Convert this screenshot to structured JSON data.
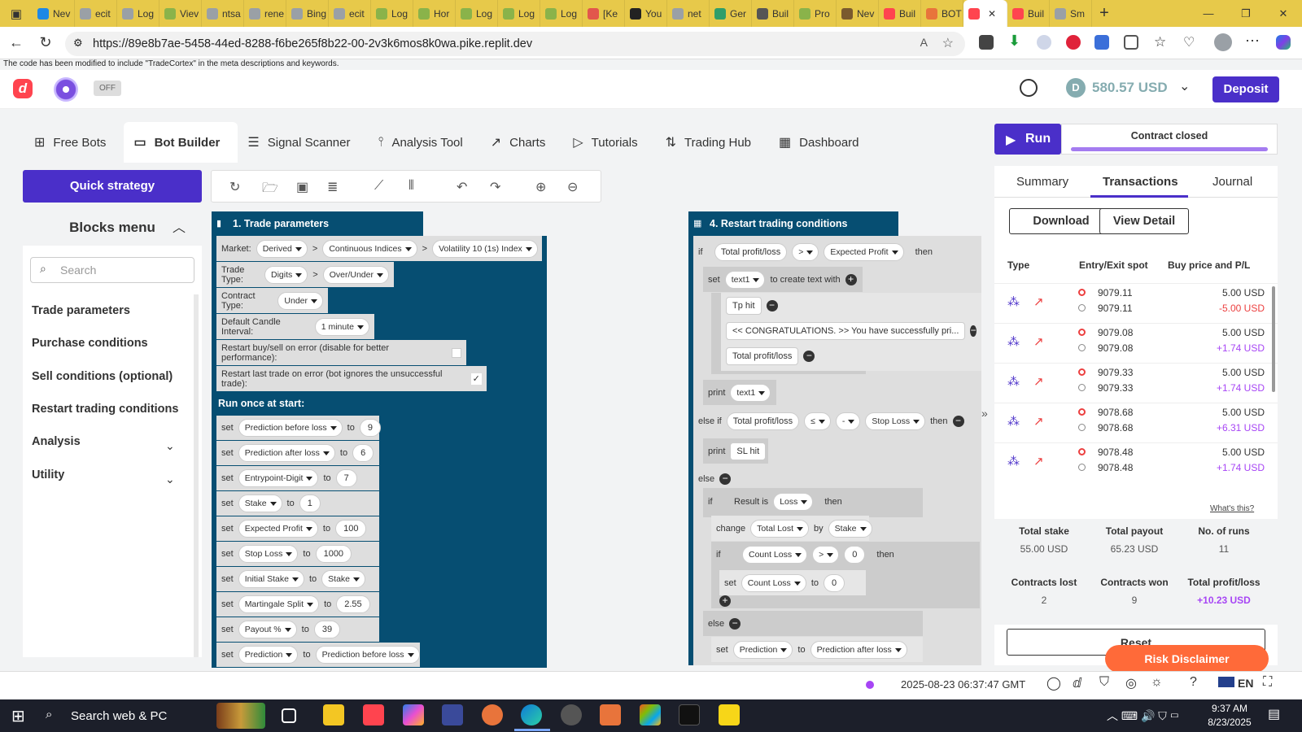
{
  "browser": {
    "tabs": [
      "Nev",
      "ecit",
      "Log",
      "Viev",
      "ntsa",
      "rene",
      "Bing",
      "ecit",
      "Log",
      "Hor",
      "Log",
      "Log",
      "Log",
      "[Ke",
      "You",
      "net",
      "Ger",
      "Buil",
      "Pro",
      "Nev",
      "Buil",
      "BOT",
      "",
      "Buil",
      "Sm"
    ],
    "url": "https://89e8b7ae-5458-44ed-8288-f6be265f8b22-00-2v3k6mos8k0wa.pike.replit.dev"
  },
  "notice": "The code has been modified to include \"TradeCortex\" in the meta descriptions and keywords.",
  "header": {
    "off": "OFF",
    "balance": "580.57 USD",
    "deposit": "Deposit"
  },
  "tabs": [
    {
      "label": "Free Bots",
      "icon": "grid-icon"
    },
    {
      "label": "Bot Builder",
      "icon": "builder-icon"
    },
    {
      "label": "Signal Scanner",
      "icon": "list-icon"
    },
    {
      "label": "Analysis Tool",
      "icon": "analysis-icon"
    },
    {
      "label": "Charts",
      "icon": "chart-icon"
    },
    {
      "label": "Tutorials",
      "icon": "play-icon"
    },
    {
      "label": "Trading Hub",
      "icon": "arrows-icon"
    },
    {
      "label": "Dashboard",
      "icon": "dashboard-icon"
    }
  ],
  "left": {
    "quick": "Quick strategy",
    "blocks_title": "Blocks menu",
    "search_placeholder": "Search",
    "items": [
      "Trade parameters",
      "Purchase conditions",
      "Sell conditions (optional)",
      "Restart trading conditions",
      "Analysis",
      "Utility"
    ]
  },
  "trade_params": {
    "title": "1. Trade parameters",
    "market_label": "Market:",
    "market": [
      "Derived",
      "Continuous Indices",
      "Volatility 10 (1s) Index"
    ],
    "trade_type_label": "Trade Type:",
    "trade_type": [
      "Digits",
      "Over/Under"
    ],
    "contract_type_label": "Contract Type:",
    "contract_type": "Under",
    "candle_label": "Default Candle Interval:",
    "candle": "1 minute",
    "restart_err": "Restart buy/sell on error (disable for better performance):",
    "restart_last": "Restart last trade on error (bot ignores the unsuccessful trade):",
    "check": "✓",
    "run_once": "Run once at start:"
  },
  "sets": [
    {
      "var": "Prediction before loss",
      "val": "9"
    },
    {
      "var": "Prediction after loss",
      "val": "6"
    },
    {
      "var": "Entrypoint-Digit",
      "val": "7"
    },
    {
      "var": "Stake",
      "val": "1"
    },
    {
      "var": "Expected Profit",
      "val": "100"
    },
    {
      "var": "Stop Loss",
      "val": "1000"
    },
    {
      "var": "Initial Stake",
      "val": "Stake"
    },
    {
      "var": "Martingale Split",
      "val": "2.55"
    },
    {
      "var": "Payout %",
      "val": "39"
    },
    {
      "var": "Prediction",
      "val": "Prediction before loss"
    }
  ],
  "restart": {
    "title": "4. Restart trading conditions",
    "if": "if",
    "total_pl": "Total profit/loss",
    "gt": ">",
    "expected": "Expected Profit",
    "then": "then",
    "set": "set",
    "text1": "text1",
    "create": "to create text with",
    "tp_hit": "Tp hit",
    "congrats": "<< CONGRATULATIONS. >> You have successfully pri...",
    "print": "print",
    "elseif": "else if",
    "le": "≤",
    "minus": "-",
    "stop_loss": "Stop Loss",
    "sl_hit": "SL hit",
    "else": "else",
    "result_is": "Result is",
    "loss": "Loss",
    "change": "change",
    "total_lost": "Total Lost",
    "by": "by",
    "stake": "Stake",
    "count_loss": "Count Loss",
    "zero": "0",
    "to": "to",
    "prediction": "Prediction",
    "pred_after": "Prediction after loss"
  },
  "right": {
    "run": "Run",
    "contract": "Contract closed",
    "tabs": [
      "Summary",
      "Transactions",
      "Journal"
    ],
    "download": "Download",
    "view": "View Detail",
    "cols": [
      "Type",
      "Entry/Exit spot",
      "Buy price and P/L"
    ],
    "rows": [
      {
        "entry": "9079.11",
        "exit": "9079.11",
        "buy": "5.00 USD",
        "pl": "-5.00 USD",
        "pl_color": "#ec3f3f"
      },
      {
        "entry": "9079.08",
        "exit": "9079.08",
        "buy": "5.00 USD",
        "pl": "+1.74 USD",
        "pl_color": "#a745f5"
      },
      {
        "entry": "9079.33",
        "exit": "9079.33",
        "buy": "5.00 USD",
        "pl": "+1.74 USD",
        "pl_color": "#a745f5"
      },
      {
        "entry": "9078.68",
        "exit": "9078.68",
        "buy": "5.00 USD",
        "pl": "+6.31 USD",
        "pl_color": "#a745f5"
      },
      {
        "entry": "9078.48",
        "exit": "9078.48",
        "buy": "5.00 USD",
        "pl": "+1.74 USD",
        "pl_color": "#a745f5"
      }
    ],
    "whats": "What's this?",
    "stats": [
      {
        "label": "Total stake",
        "value": "55.00 USD"
      },
      {
        "label": "Total payout",
        "value": "65.23 USD"
      },
      {
        "label": "No. of runs",
        "value": "11"
      },
      {
        "label": "Contracts lost",
        "value": "2"
      },
      {
        "label": "Contracts won",
        "value": "9"
      },
      {
        "label": "Total profit/loss",
        "value": "+10.23 USD"
      }
    ],
    "reset": "Reset",
    "risk": "Risk Disclaimer"
  },
  "footer": {
    "time": "2025-08-23 06:37:47 GMT",
    "lang": "EN"
  },
  "taskbar": {
    "search": "Search web & PC",
    "time": "9:37 AM",
    "date": "8/23/2025"
  }
}
